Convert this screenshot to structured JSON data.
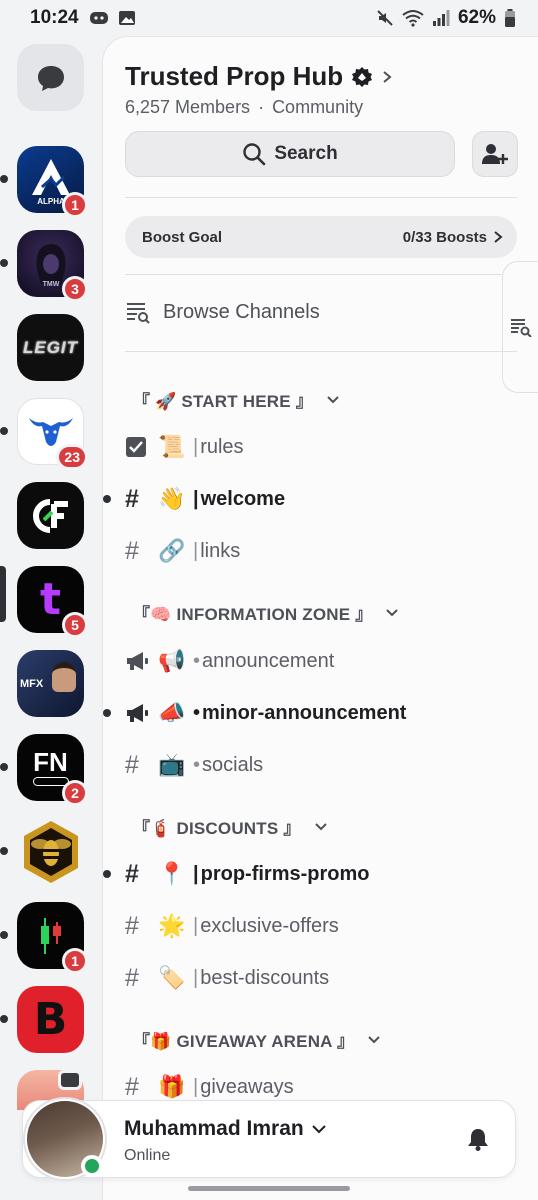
{
  "status_bar": {
    "time": "10:24",
    "battery": "62%"
  },
  "servers": [
    {
      "name": "direct-messages",
      "tile_text": "",
      "badge": "",
      "bg": "#e3e5e8"
    },
    {
      "name": "alpha",
      "tile_text": "ALPH",
      "badge": "1",
      "bg": "#0d2a6b"
    },
    {
      "name": "tmw",
      "tile_text": "TMW",
      "badge": "3",
      "bg": "#1c1430"
    },
    {
      "name": "legit",
      "tile_text": "LEGIT",
      "badge": "",
      "bg": "#111111"
    },
    {
      "name": "bull",
      "tile_text": "",
      "badge": "23",
      "bg": "#ffffff"
    },
    {
      "name": "cf",
      "tile_text": "CF",
      "badge": "",
      "bg": "#0b0b0b"
    },
    {
      "name": "t-purple",
      "tile_text": "t",
      "badge": "5",
      "bg": "#0a0a0a"
    },
    {
      "name": "mfx",
      "tile_text": "MFX",
      "badge": "",
      "bg": "#1d2a4a"
    },
    {
      "name": "fn",
      "tile_text": "FN",
      "badge": "2",
      "bg": "#050505"
    },
    {
      "name": "bee",
      "tile_text": "",
      "badge": "",
      "bg": "#f2f3f5"
    },
    {
      "name": "candles",
      "tile_text": "",
      "badge": "1",
      "bg": "#050505"
    },
    {
      "name": "b-red",
      "tile_text": "B",
      "badge": "",
      "bg": "#e0202b"
    }
  ],
  "guild": {
    "title": "Trusted Prop Hub",
    "members": "6,257 Members",
    "dot": "·",
    "type": "Community",
    "search_label": "Search"
  },
  "boost": {
    "label": "Boost Goal",
    "count": "0/33 Boosts"
  },
  "browse_label": "Browse Channels",
  "categories": [
    {
      "label": "『 🚀 START HERE 』"
    },
    {
      "label": "『🧠 INFORMATION ZONE 』"
    },
    {
      "label": "『🧯 DISCOUNTS 』"
    },
    {
      "label": "『🎁 GIVEAWAY ARENA 』"
    }
  ],
  "channels": [
    {
      "icon": "rules-icon",
      "emoji": "📜",
      "sep": "|",
      "name": "rules"
    },
    {
      "icon": "hash-icon",
      "emoji": "👋",
      "sep": "|",
      "name": "welcome"
    },
    {
      "icon": "hash-icon",
      "emoji": "🔗",
      "sep": "|",
      "name": "links"
    },
    {
      "icon": "megaphone-icon",
      "emoji": "📢",
      "sep": "•",
      "name": "announcement"
    },
    {
      "icon": "megaphone-icon",
      "emoji": "📣",
      "sep": "•",
      "name": "minor-announcement"
    },
    {
      "icon": "hash-icon",
      "emoji": "📺",
      "sep": "•",
      "name": "socials"
    },
    {
      "icon": "hash-icon",
      "emoji": "📍",
      "sep": "|",
      "name": "prop-firms-promo"
    },
    {
      "icon": "hash-icon",
      "emoji": "🌟",
      "sep": "|",
      "name": "exclusive-offers"
    },
    {
      "icon": "hash-icon",
      "emoji": "🏷️",
      "sep": "|",
      "name": "best-discounts"
    },
    {
      "icon": "hash-icon",
      "emoji": "🎁",
      "sep": "|",
      "name": "giveaways"
    }
  ],
  "user": {
    "name": "Muhammad Imran",
    "status": "Online"
  }
}
